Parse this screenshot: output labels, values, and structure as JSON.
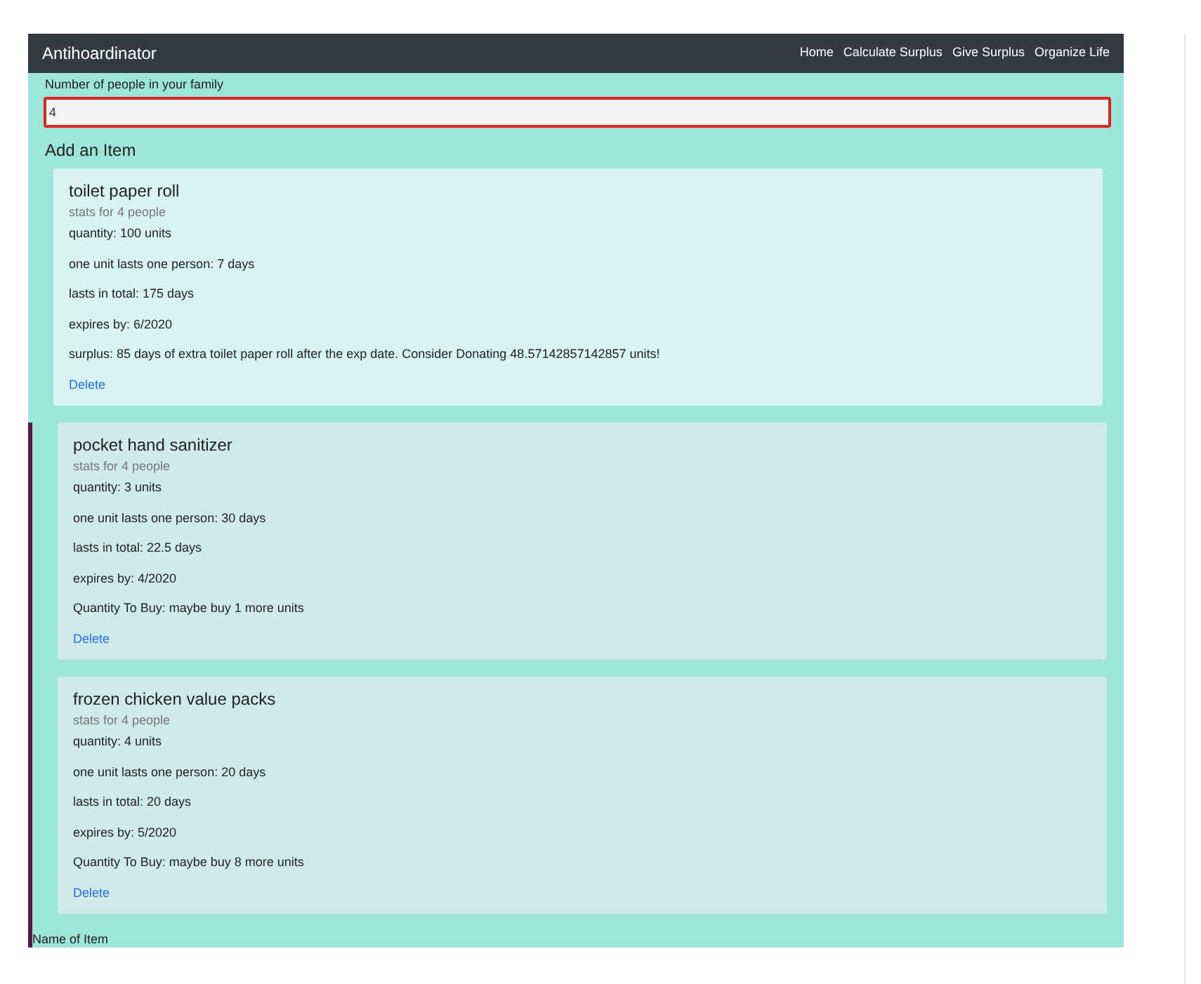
{
  "navbar": {
    "brand": "Antihoardinator",
    "links": [
      "Home",
      "Calculate Surplus",
      "Give Surplus",
      "Organize Life"
    ]
  },
  "family_field": {
    "label": "Number of people in your family",
    "value": "4",
    "invalid": true
  },
  "add_heading": "Add an Item",
  "items": [
    {
      "kind": "surplus",
      "title": "toilet paper roll",
      "subtitle": "stats for 4 people",
      "details": [
        "quantity: 100 units",
        "one unit lasts one person: 7 days",
        "lasts in total: 175 days",
        "expires by: 6/2020",
        "surplus: 85 days of extra toilet paper roll after the exp date. Consider Donating 48.57142857142857 units!"
      ],
      "delete": "Delete"
    },
    {
      "kind": "to_buy",
      "title": "pocket hand sanitizer",
      "subtitle": "stats for 4 people",
      "details": [
        "quantity: 3 units",
        "one unit lasts one person: 30 days",
        "lasts in total: 22.5 days",
        "expires by: 4/2020",
        "Quantity To Buy: maybe buy 1 more units"
      ],
      "delete": "Delete"
    },
    {
      "kind": "to_buy",
      "title": "frozen chicken value packs",
      "subtitle": "stats for 4 people",
      "details": [
        "quantity: 4 units",
        "one unit lasts one person: 20 days",
        "lasts in total: 20 days",
        "expires by: 5/2020",
        "Quantity To Buy: maybe buy 8 more units"
      ],
      "delete": "Delete"
    }
  ],
  "name_label": "Name of Item"
}
